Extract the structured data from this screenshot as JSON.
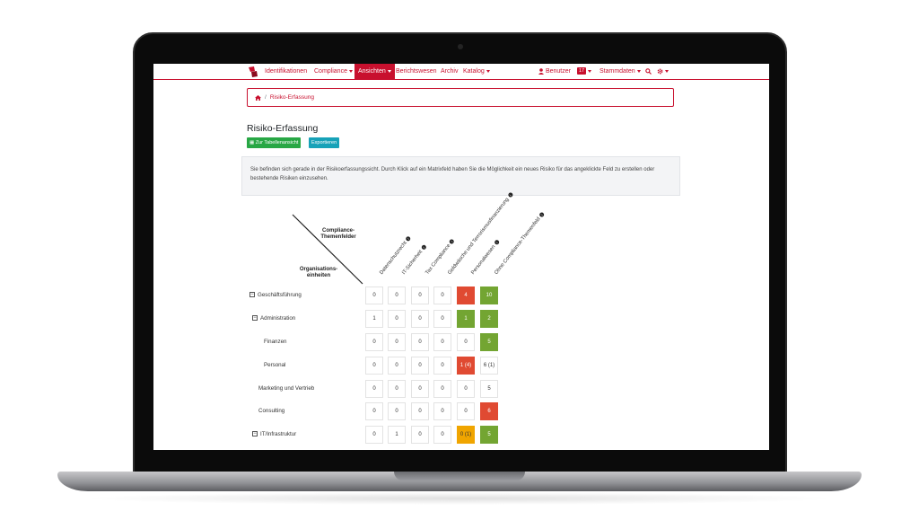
{
  "nav": {
    "items": [
      "Identifikationen",
      "Compliance",
      "Ansichten",
      "Berichtswesen",
      "Archiv",
      "Katalog"
    ],
    "user_label": "Benutzer",
    "notifications_count": "17",
    "master_data_label": "Stammdaten"
  },
  "breadcrumb": {
    "current": "Risiko-Erfassung"
  },
  "page": {
    "title": "Risiko-Erfassung",
    "btn_table_view": "Zur Tabellenansicht",
    "btn_export": "Exportieren",
    "info_text": "Sie befinden sich gerade in der Risikoerfassungssicht. Durch Klick auf ein Matrixfeld haben Sie die Möglichkeit ein neues Risiko für das angeklickte Feld zu erstellen oder bestehende Risiken einzusehen."
  },
  "matrix": {
    "axis_top": "Compliance-\nThemenfelder",
    "axis_left": "Organisations-\neinheiten",
    "columns": [
      "Datenschutzrecht",
      "IT-Sicherheit",
      "Tax Compliance",
      "Geldwäsche und Terrorismusfinanzierung",
      "Personalwesen",
      "Ohne Compliance-Themenfeld"
    ],
    "rows": [
      {
        "label": "Geschäftsführung",
        "toggle": "−",
        "cells": [
          "0",
          "0",
          "0",
          "0",
          "4",
          "10"
        ],
        "colors": [
          "",
          "",
          "",
          "",
          "red",
          "green"
        ]
      },
      {
        "label": "Administration",
        "toggle": "−",
        "cells": [
          "1",
          "0",
          "0",
          "0",
          "1",
          "2"
        ],
        "colors": [
          "",
          "",
          "",
          "",
          "green",
          "green"
        ]
      },
      {
        "label": "Finanzen",
        "toggle": "",
        "cells": [
          "0",
          "0",
          "0",
          "0",
          "0",
          "5"
        ],
        "colors": [
          "",
          "",
          "",
          "",
          "",
          "green"
        ]
      },
      {
        "label": "Personal",
        "toggle": "",
        "cells": [
          "0",
          "0",
          "0",
          "0",
          "1 (4)",
          "6 (1)"
        ],
        "colors": [
          "",
          "",
          "",
          "",
          "red",
          ""
        ]
      },
      {
        "label": "Marketing und Vertrieb",
        "toggle": "",
        "cells": [
          "0",
          "0",
          "0",
          "0",
          "0",
          "5"
        ],
        "colors": [
          "",
          "",
          "",
          "",
          "",
          ""
        ]
      },
      {
        "label": "Consulting",
        "toggle": "",
        "cells": [
          "0",
          "0",
          "0",
          "0",
          "0",
          "6"
        ],
        "colors": [
          "",
          "",
          "",
          "",
          "",
          "red"
        ]
      },
      {
        "label": "IT/Infrastruktur",
        "toggle": "−",
        "cells": [
          "0",
          "1",
          "0",
          "0",
          "0 (1)",
          "5"
        ],
        "colors": [
          "",
          "",
          "",
          "",
          "orange",
          "green"
        ]
      }
    ]
  },
  "colors": {
    "brand": "#c8102e",
    "risk_high": "#e04a32",
    "risk_ok": "#73a532",
    "risk_mid": "#f0a500"
  }
}
